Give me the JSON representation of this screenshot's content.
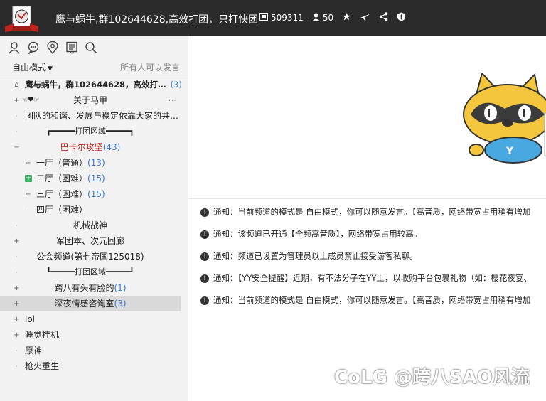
{
  "header": {
    "title": "鹰与蜗牛,群102644628,高效打团，只打快团",
    "channel_id": "509311",
    "member_count": "50",
    "icons": [
      "id-card-icon",
      "user-icon",
      "star-icon",
      "airplane-icon",
      "share-icon",
      "alert-icon"
    ]
  },
  "toolbar": {
    "icons": [
      "user-icon",
      "chat-icon",
      "location-icon",
      "notes-icon",
      "search-icon"
    ]
  },
  "mode": {
    "label": "自由模式",
    "speak_permission": "所有人可以发言"
  },
  "tree": [
    {
      "label": "鹰与蜗牛，群102644628，高效打…",
      "count": "(3)",
      "bold": true,
      "icon": "home"
    },
    {
      "label": "关于马甲",
      "prefix": "☜♥☞",
      "more": "···",
      "icon": "plus"
    },
    {
      "label": "团队的和谐、发展与稳定依靠大家的共…",
      "icon": "dot"
    },
    {
      "label": "┏━━━━━打团区域━━━━━┓",
      "icon": "dot"
    },
    {
      "label": "巴卡尔攻坚",
      "count": "(43)",
      "red": true,
      "icon": "minus"
    },
    {
      "label": "一厅（普通）",
      "count": "(13)",
      "icon": "plus",
      "indent": true
    },
    {
      "label": "二厅（困难）",
      "count": "(15)",
      "icon": "greenplus",
      "indent": true
    },
    {
      "label": "三厅（困难）",
      "count": "(15)",
      "icon": "plus",
      "indent": true
    },
    {
      "label": "四厅（困难）",
      "icon": "dot",
      "indent": true
    },
    {
      "label": "机械战神",
      "icon": "dot"
    },
    {
      "label": "军团本、次元回廊",
      "icon": "plus"
    },
    {
      "label": "公会频道(第七帝国125018)",
      "icon": "dot"
    },
    {
      "label": "┗━━━━━打团区域━━━━━┛",
      "icon": "dot"
    },
    {
      "label": "跨八有头有脸的",
      "count": "(1)",
      "icon": "plus"
    },
    {
      "label": "深夜情感咨询室",
      "count": "(3)",
      "icon": "plus",
      "selected": true
    },
    {
      "label": "lol",
      "icon": "plus"
    },
    {
      "label": "睡觉挂机",
      "icon": "plus"
    },
    {
      "label": "原神",
      "icon": "dot"
    },
    {
      "label": "枪火重生",
      "icon": "dot"
    }
  ],
  "messages": [
    "通知：当前频道的模式是 自由模式，你可以随意发言。【高音质，网络带宽占用稍有增加",
    "通知：该频道已开通【全频高音质】，网络带宽占用较高。",
    "通知：频道已设置为管理员以上成员禁止接受游客私聊。",
    "通知：【YY安全提醒】近期，有不法分子在YY上，以收购平台包裹礼物（如：樱花夜宴、",
    "通知：当前频道的模式是 自由模式，你可以随意发言。【高音质，网络带宽占用稍有增加"
  ],
  "watermark": "CoLG @跨八SAO风流",
  "colors": {
    "titlebar": "#2b2b2b",
    "count": "#3a7bd5",
    "highlight": "#c0251d",
    "green": "#3fb468",
    "mascot": "#f4c63d"
  }
}
